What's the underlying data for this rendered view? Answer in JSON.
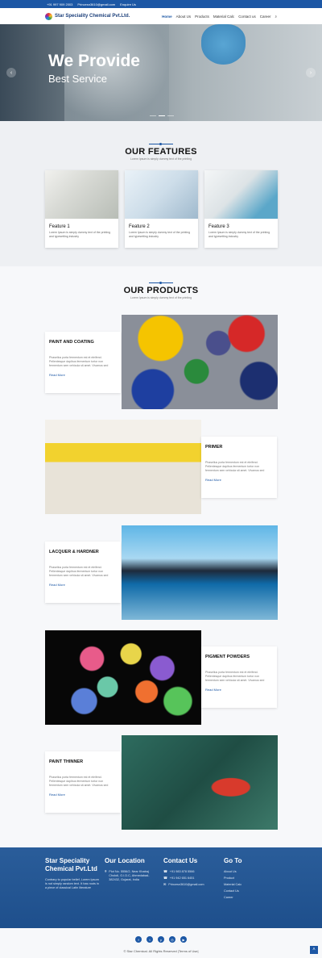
{
  "topbar": {
    "phone": "+91 997 909 2003",
    "email": "Princesn3610@gmail.com",
    "inquiry": "Enquire Us"
  },
  "brand": {
    "name": "Star Speciality Chemical Pvt.Ltd."
  },
  "menu": [
    "Home",
    "About Us",
    "Products",
    "Material Calc",
    "Contact us",
    "Career"
  ],
  "hero": {
    "title": "We Provide",
    "subtitle": "Best Service"
  },
  "features": {
    "title": "OUR FEATURES",
    "subtitle": "Lorem Ipsum is simply dummy text of the printing",
    "items": [
      {
        "title": "Feature 1",
        "text": "Lorem Ipsum is simply dummy text of the printing and typesetting industry"
      },
      {
        "title": "Feature 2",
        "text": "Lorem Ipsum is simply dummy text of the printing and typesetting industry"
      },
      {
        "title": "Feature 3",
        "text": "Lorem Ipsum is simply dummy text of the printing and typesetting industry"
      }
    ]
  },
  "products": {
    "title": "OUR PRODUCTS",
    "subtitle": "Lorem Ipsum is simply dummy text of the printing",
    "read_more": "Read More",
    "desc": "Phasellus porta fermentum est et eleifend. Pellentesque dapibus fermentum tortor non fermentum sem vehicula sit amet. Vivamus sed",
    "items": [
      "PAINT AND COATING",
      "PRIMER",
      "LACQUER & HARDNER",
      "PIGMENT POWDERS",
      "PAINT THINNER"
    ]
  },
  "footer": {
    "company": "Star Speciality Chemical Pvt.Ltd",
    "about": "Contrary to popular belief, Lorem Ipsum is not simply random text. It has roots in a piece of classical Latin literature",
    "location_title": "Our Location",
    "address": "Plot No. 5556/2, Near Khatraj Chokdi, G.I.D.C, Ahmedabad-382432, Gujarat, India",
    "contact_title": "Contact Us",
    "phone1": "+91 983 878 5566",
    "phone2": "+91 942 651 6451",
    "email": "Princesn3610@gmail.com",
    "goto_title": "Go To",
    "links": [
      "About Us",
      "Product",
      "Material Calc",
      "Contact Us",
      "Career"
    ],
    "copyright": "© Star Chemical. All Rights Reserved |Terms of Use|"
  }
}
